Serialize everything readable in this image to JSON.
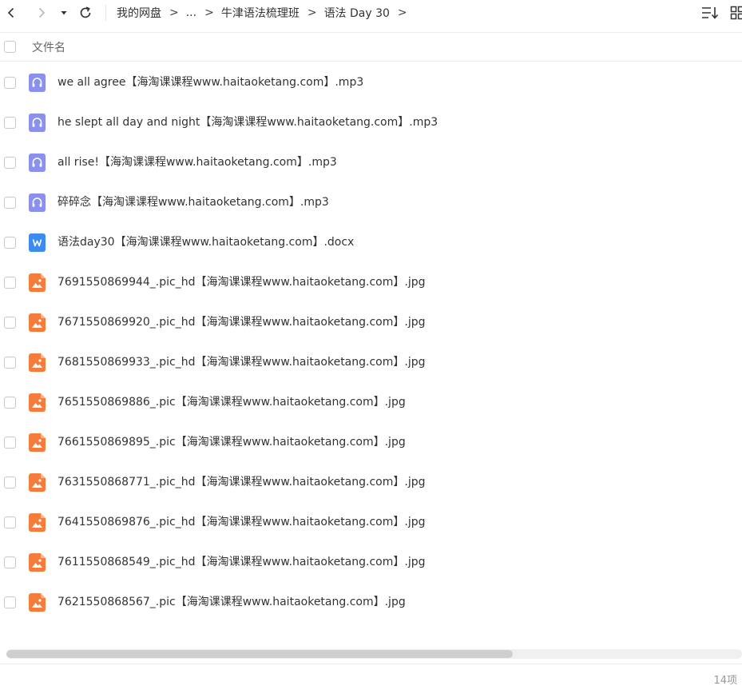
{
  "toolbar": {
    "back_icon": "chevron-left-icon",
    "forward_icon": "chevron-right-icon",
    "dropdown_icon": "caret-down-icon",
    "refresh_icon": "refresh-icon",
    "sort_icon": "sort-icon",
    "view_icon": "grid-view-icon"
  },
  "breadcrumb": {
    "items": [
      "我的网盘",
      "...",
      "牛津语法梳理班",
      "语法 Day 30"
    ],
    "separator": ">"
  },
  "list": {
    "header": {
      "name_label": "文件名"
    },
    "files": [
      {
        "name": "we all agree【海淘课课程www.haitaoketang.com】.mp3",
        "type": "audio"
      },
      {
        "name": "he slept all day and night【海淘课课程www.haitaoketang.com】.mp3",
        "type": "audio"
      },
      {
        "name": "all rise!【海淘课课程www.haitaoketang.com】.mp3",
        "type": "audio"
      },
      {
        "name": "碎碎念【海淘课课程www.haitaoketang.com】.mp3",
        "type": "audio"
      },
      {
        "name": "语法day30【海淘课课程www.haitaoketang.com】.docx",
        "type": "word"
      },
      {
        "name": "7691550869944_.pic_hd【海淘课课程www.haitaoketang.com】.jpg",
        "type": "image"
      },
      {
        "name": "7671550869920_.pic_hd【海淘课课程www.haitaoketang.com】.jpg",
        "type": "image"
      },
      {
        "name": "7681550869933_.pic_hd【海淘课课程www.haitaoketang.com】.jpg",
        "type": "image"
      },
      {
        "name": "7651550869886_.pic【海淘课课程www.haitaoketang.com】.jpg",
        "type": "image"
      },
      {
        "name": "7661550869895_.pic【海淘课课程www.haitaoketang.com】.jpg",
        "type": "image"
      },
      {
        "name": "7631550868771_.pic_hd【海淘课课程www.haitaoketang.com】.jpg",
        "type": "image"
      },
      {
        "name": "7641550869876_.pic_hd【海淘课课程www.haitaoketang.com】.jpg",
        "type": "image"
      },
      {
        "name": "7611550868549_.pic_hd【海淘课课程www.haitaoketang.com】.jpg",
        "type": "image"
      },
      {
        "name": "7621550868567_.pic【海淘课课程www.haitaoketang.com】.jpg",
        "type": "image"
      }
    ]
  },
  "status": {
    "count_label": "14项"
  },
  "colors": {
    "audio_icon": "#8a8ff0",
    "word_icon": "#3d8bf0",
    "image_icon": "#f67c3c",
    "text": "#333333",
    "muted": "#999999"
  }
}
